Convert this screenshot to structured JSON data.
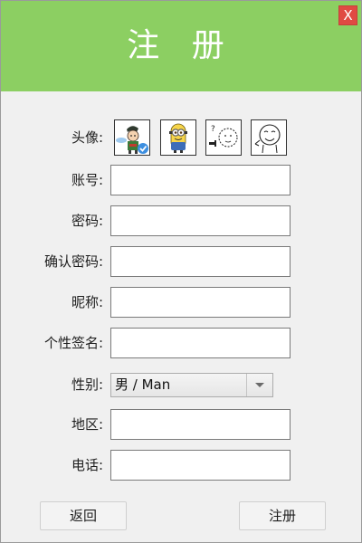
{
  "window": {
    "title": "注 册",
    "close_label": "X",
    "header_color": "#8ccf62",
    "close_color": "#e04a43"
  },
  "form": {
    "avatar_label": "头像:",
    "avatars": [
      {
        "name": "boy-waving-avatar",
        "selected": true
      },
      {
        "name": "minion-avatar",
        "selected": false
      },
      {
        "name": "question-face-avatar",
        "selected": false
      },
      {
        "name": "waving-face-avatar",
        "selected": false
      }
    ],
    "account_label": "账号:",
    "account_value": "",
    "password_label": "密码:",
    "password_value": "",
    "confirm_password_label": "确认密码:",
    "confirm_password_value": "",
    "nickname_label": "昵称:",
    "nickname_value": "",
    "signature_label": "个性签名:",
    "signature_value": "",
    "gender_label": "性别:",
    "gender_value": "男 / Man",
    "region_label": "地区:",
    "region_value": "",
    "phone_label": "电话:",
    "phone_value": ""
  },
  "buttons": {
    "back_label": "返回",
    "register_label": "注册"
  }
}
